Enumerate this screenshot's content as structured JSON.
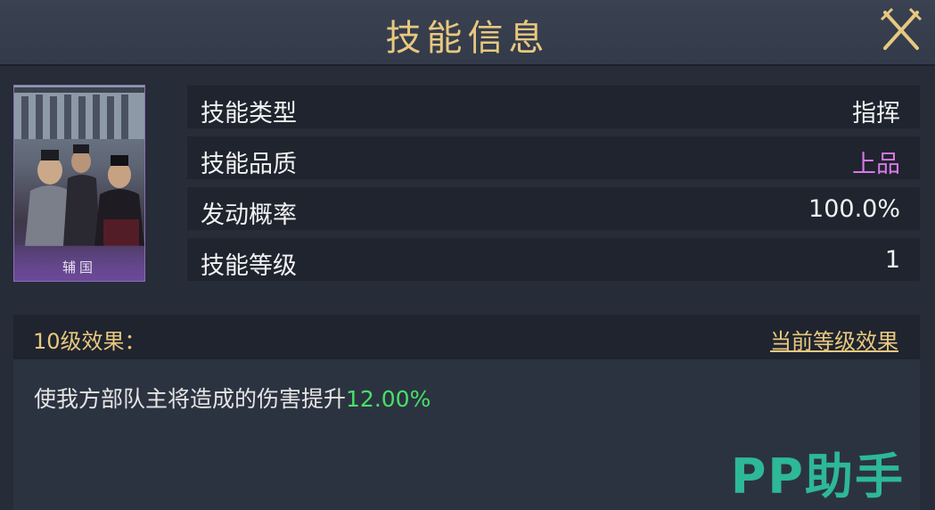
{
  "dialog": {
    "title": "技能信息",
    "close_icon": "close-icon"
  },
  "portrait": {
    "name": "辅国"
  },
  "info": [
    {
      "label": "技能类型",
      "value": "指挥",
      "value_color": "#f2f2f2"
    },
    {
      "label": "技能品质",
      "value": "上品",
      "value_color": "#d878e8"
    },
    {
      "label": "发动概率",
      "value": "100.0%",
      "value_color": "#f2f2f2"
    },
    {
      "label": "技能等级",
      "value": "1",
      "value_color": "#f2f2f2"
    }
  ],
  "effect": {
    "header": "10级效果：",
    "link": "当前等级效果",
    "description": "使我方部队主将造成的伤害提升",
    "value": "12.00%",
    "value_color": "#46e06a"
  },
  "watermark": "PP助手",
  "colors": {
    "accent_gold": "#e8c880",
    "quality_purple": "#d878e8",
    "positive_green": "#46e06a"
  }
}
